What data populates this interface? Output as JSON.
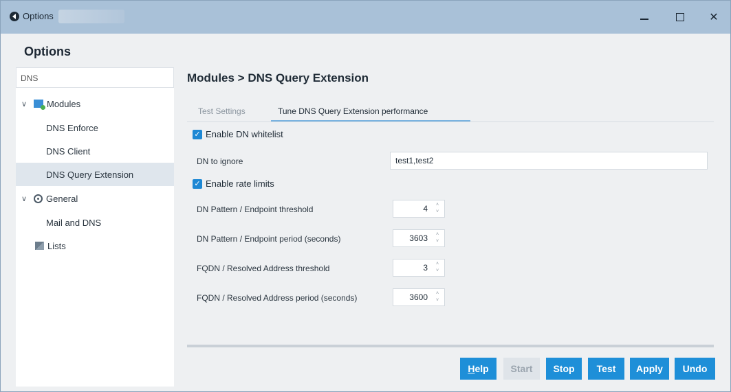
{
  "window": {
    "title": "Options",
    "close_glyph": "✕"
  },
  "options_heading": "Options",
  "sidebar": {
    "search_value": "DNS",
    "items": [
      {
        "label": "Modules",
        "icon": "modules-icon",
        "expanded": true
      },
      {
        "label": "DNS Enforce"
      },
      {
        "label": "DNS Client"
      },
      {
        "label": "DNS Query Extension",
        "selected": true
      },
      {
        "label": "General",
        "icon": "gear-icon",
        "expanded": true
      },
      {
        "label": "Mail and DNS"
      },
      {
        "label": "Lists",
        "icon": "lists-icon"
      }
    ],
    "chevron": "∨"
  },
  "main": {
    "title": "Modules > DNS Query Extension",
    "tabs": [
      {
        "label": "Test Settings",
        "active": false
      },
      {
        "label": "Tune DNS Query Extension performance",
        "active": true
      }
    ],
    "enable_whitelist": {
      "label": "Enable DN whitelist",
      "checked": true
    },
    "dn_to_ignore": {
      "label": "DN to ignore",
      "value": "test1,test2"
    },
    "enable_rate_limits": {
      "label": "Enable rate limits",
      "checked": true
    },
    "spinners": [
      {
        "label": "DN Pattern / Endpoint threshold",
        "value": "4"
      },
      {
        "label": "DN Pattern / Endpoint period (seconds)",
        "value": "3603"
      },
      {
        "label": "FQDN / Resolved Address threshold",
        "value": "3"
      },
      {
        "label": "FQDN / Resolved Address period (seconds)",
        "value": "3600"
      }
    ],
    "check_glyph": "✓",
    "spin_up": "˄",
    "spin_down": "˅"
  },
  "buttons": {
    "help_first": "H",
    "help_rest": "elp",
    "start": "Start",
    "stop": "Stop",
    "test": "Test",
    "apply": "Apply",
    "undo": "Undo"
  },
  "colors": {
    "titlebar": "#a9c1d8",
    "accent": "#1e8fd8",
    "selection": "#dfe6ed"
  }
}
